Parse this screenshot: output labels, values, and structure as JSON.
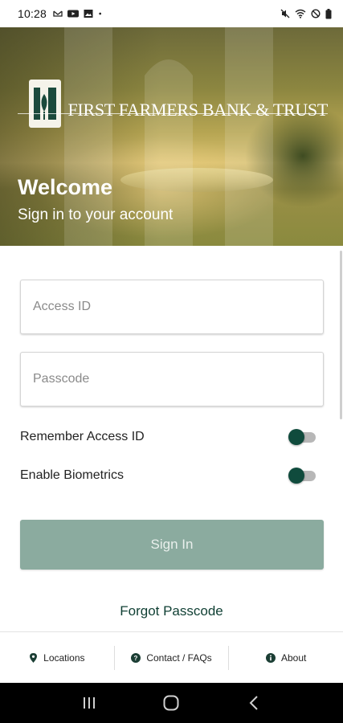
{
  "status_bar": {
    "time": "10:28",
    "left_icons": [
      "mail-icon",
      "youtube-icon",
      "gallery-icon",
      "dot-icon"
    ],
    "right_icons": [
      "mute-icon",
      "wifi-icon",
      "do-not-disturb-icon",
      "battery-icon"
    ]
  },
  "header": {
    "logo_text": "FIRST FARMERS BANK & TRUST",
    "welcome": "Welcome",
    "subtitle": "Sign in to your account"
  },
  "form": {
    "access_id": {
      "placeholder": "Access ID",
      "value": ""
    },
    "passcode": {
      "placeholder": "Passcode",
      "value": ""
    },
    "remember_label": "Remember Access ID",
    "remember_on": true,
    "biometrics_label": "Enable Biometrics",
    "biometrics_on": true,
    "signin_label": "Sign In",
    "forgot_label": "Forgot Passcode"
  },
  "bottom_nav": {
    "items": [
      {
        "label": "Locations",
        "icon": "location-pin-icon"
      },
      {
        "label": "Contact / FAQs",
        "icon": "help-icon"
      },
      {
        "label": "About",
        "icon": "info-icon"
      }
    ]
  },
  "system_nav": [
    "recents-icon",
    "home-icon",
    "back-icon"
  ],
  "colors": {
    "brand_green": "#104b3d",
    "button_disabled": "#8bab9f",
    "link_green": "#0f3f33"
  }
}
